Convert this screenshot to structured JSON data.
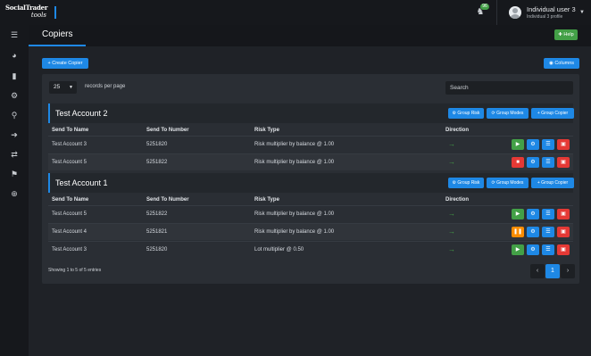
{
  "brand": {
    "line1": "SocialTrader",
    "line2": "tools"
  },
  "notifications": {
    "count": "96"
  },
  "user": {
    "name": "Individual user 3",
    "profile": "Individual 3 profile"
  },
  "page": {
    "title": "Copiers",
    "help_label": "Help"
  },
  "toolbar": {
    "create_label": "+ Create Copier",
    "columns_label": "Columns"
  },
  "table_controls": {
    "page_size": "25",
    "records_label": "records per page",
    "search_placeholder": "Search"
  },
  "columns": [
    "Send To Name",
    "Send To Number",
    "Risk Type",
    "Direction"
  ],
  "group_buttons": {
    "risk": "Group Risk",
    "modes": "Group Modes",
    "copier": "+ Group Copier"
  },
  "groups": [
    {
      "title": "Test Account 2",
      "rows": [
        {
          "name": "Test Account 3",
          "number": "5251820",
          "risk": "Risk multiplier by balance @ 1.00",
          "direction": "→",
          "state": "play"
        },
        {
          "name": "Test Account 5",
          "number": "5251822",
          "risk": "Risk multiplier by balance @ 1.00",
          "direction": "→",
          "state": "stop"
        }
      ]
    },
    {
      "title": "Test Account 1",
      "rows": [
        {
          "name": "Test Account 5",
          "number": "5251822",
          "risk": "Risk multiplier by balance @ 1.00",
          "direction": "→",
          "state": "play"
        },
        {
          "name": "Test Account 4",
          "number": "5251821",
          "risk": "Risk multiplier by balance @ 1.00",
          "direction": "→",
          "state": "pause"
        },
        {
          "name": "Test Account 3",
          "number": "5251820",
          "risk": "Lot multiplier @ 0.50",
          "direction": "→",
          "state": "play"
        }
      ]
    }
  ],
  "footer": {
    "showing": "Showing 1 to 5 of 5 entries",
    "current_page": "1",
    "prev": "‹",
    "next": "›"
  },
  "colors": {
    "primary": "#1e88e5",
    "success": "#43a047",
    "danger": "#e53935",
    "warning": "#fb8c00"
  }
}
